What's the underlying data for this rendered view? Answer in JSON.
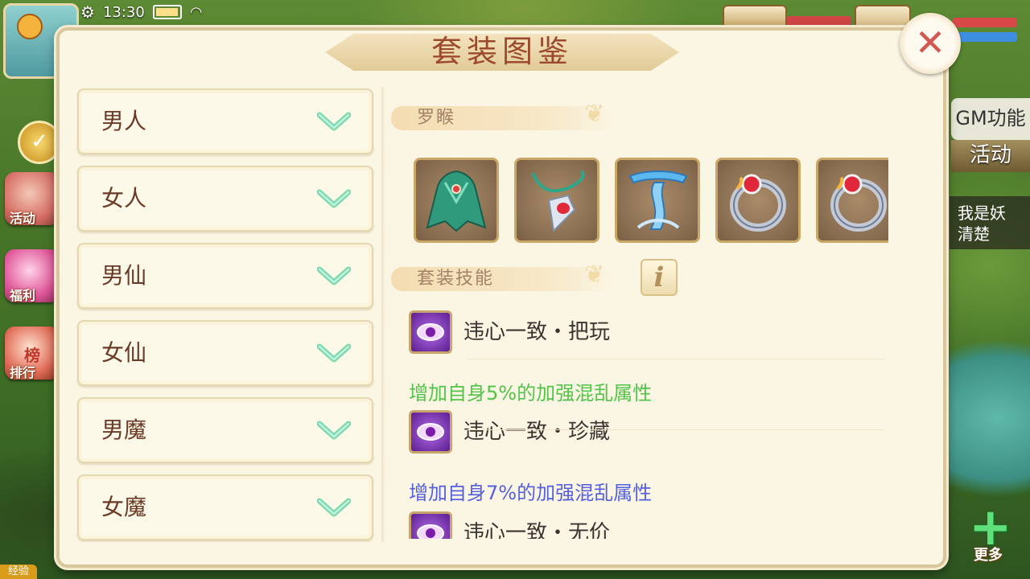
{
  "status_bar": {
    "time": "13:30"
  },
  "dialog": {
    "title": "套装图鉴",
    "categories": [
      {
        "label": "男人"
      },
      {
        "label": "女人"
      },
      {
        "label": "男仙"
      },
      {
        "label": "女仙"
      },
      {
        "label": "男魔"
      },
      {
        "label": "女魔"
      }
    ],
    "set_name": "罗睺",
    "set_items": [
      {
        "icon": "green-cloak-icon"
      },
      {
        "icon": "red-gem-pendant-icon"
      },
      {
        "icon": "blue-ribbon-icon"
      },
      {
        "icon": "red-gem-ring-icon"
      },
      {
        "icon": "red-gem-ring-icon"
      }
    ],
    "skills_header": "套装技能",
    "info_label": "i",
    "skills": [
      {
        "name": "违心一致・把玩",
        "desc": "增加自身5%的加强混乱属性",
        "desc_color": "#52c44a"
      },
      {
        "name": "违心一致・珍藏",
        "desc": "增加自身7%的加强混乱属性",
        "desc_color": "#5560e0"
      },
      {
        "name": "违心一致・无价"
      }
    ]
  },
  "side_left": {
    "activity_label": "活动",
    "welfare_label": "福利",
    "rank_label": "排行",
    "rank_badge": "榜",
    "exp_label": "经验"
  },
  "side_right": {
    "gm_label": "GM功能",
    "activity_label": "活动",
    "chat_line1": "我是妖",
    "chat_line2": "清楚",
    "more_label": "更多"
  }
}
